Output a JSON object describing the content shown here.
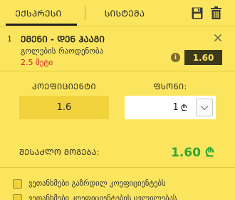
{
  "tabs": {
    "express": "ᲔᲥᲡᲞᲠᲔᲡᲘ",
    "system": "ᲡᲘᲡᲢᲔᲛᲐ"
  },
  "bet": {
    "index": "1",
    "match": "ᲔᲛᲔᲜᲘ - ᲓᲔᲜ ᲰᲐᲐᲒᲘ",
    "market": "გოლების რაოდენობა",
    "outcome": "2.5 მეტი",
    "odd": "1.60"
  },
  "coefficient": {
    "label": "ᲙᲝᲔᲤᲘᲪᲘᲔᲜᲢᲘ",
    "value": "1.6"
  },
  "stake": {
    "label": "ᲤᲡᲝᲜᲘ:",
    "value": "1",
    "currency": "₾"
  },
  "possible_win": {
    "label": "ᲨᲔᲡᲐᲫᲚᲝ ᲛᲝᲒᲔᲑᲐ:",
    "value": "1.60 ₾"
  },
  "options": [
    "ვეთანხმები გაზრდილ კოეფიციენტებს",
    "ვეთანხმები კოეფიციენტების ცვლილებას"
  ],
  "colors": {
    "background": "#fbe55e",
    "odd_badge": "#3d3a1c",
    "win": "#2ea832",
    "outcome": "#d0202a"
  }
}
